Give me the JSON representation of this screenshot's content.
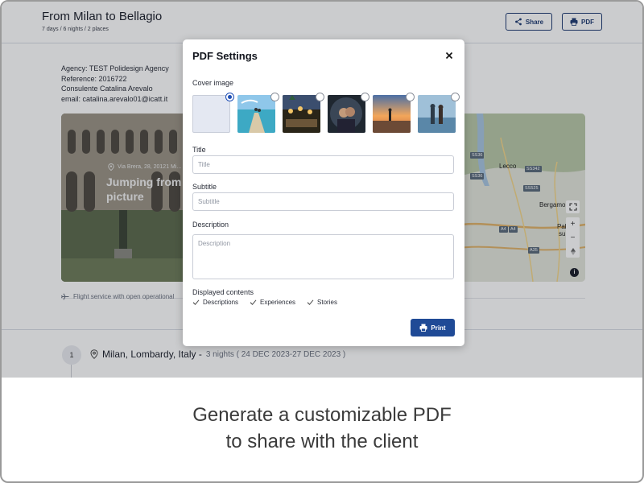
{
  "header": {
    "title": "From Milan to Bellagio",
    "subtitle": "7 days / 6 nights / 2 places",
    "share_label": "Share",
    "pdf_label": "PDF"
  },
  "agency": {
    "line1": "Agency: TEST Polidesign Agency",
    "line2": "Reference: 2016722",
    "line3": "Consulente Catalina Arevalo",
    "line4": "email: catalina.arevalo01@icatt.it"
  },
  "hero": {
    "location": "Via Brera, 28, 20121 Mi...",
    "title_line1": "Jumping from",
    "title_line2": "picture"
  },
  "map": {
    "labels": [
      "Lecco",
      "Bergamo",
      "Palaz",
      "sull",
      "nza"
    ],
    "badges": [
      "SS36",
      "SS36",
      "SS342",
      "SS525",
      "A4",
      "A4",
      "A35"
    ],
    "zoom_in": "+",
    "zoom_out": "−",
    "info": "i"
  },
  "flight_text": "Flight service with open operational",
  "day": {
    "number": "1",
    "location": "Milan, Lombardy, Italy -",
    "nights": "3 nights ( 24 DEC 2023-27 DEC 2023 )"
  },
  "modal": {
    "title": "PDF Settings",
    "cover_label": "Cover image",
    "title_label": "Title",
    "title_placeholder": "Title",
    "subtitle_label": "Subtitle",
    "subtitle_placeholder": "Subtitle",
    "description_label": "Description",
    "description_placeholder": "Description",
    "contents_label": "Displayed contents",
    "contents": [
      "Descriptions",
      "Experiences",
      "Stories"
    ],
    "print_label": "Print",
    "selected_cover": 0
  },
  "caption": {
    "line1": "Generate a customizable PDF",
    "line2": "to share with the client"
  },
  "colors": {
    "accent": "#1f4a96",
    "border": "#c9cdd6",
    "text": "#2a2e39"
  }
}
